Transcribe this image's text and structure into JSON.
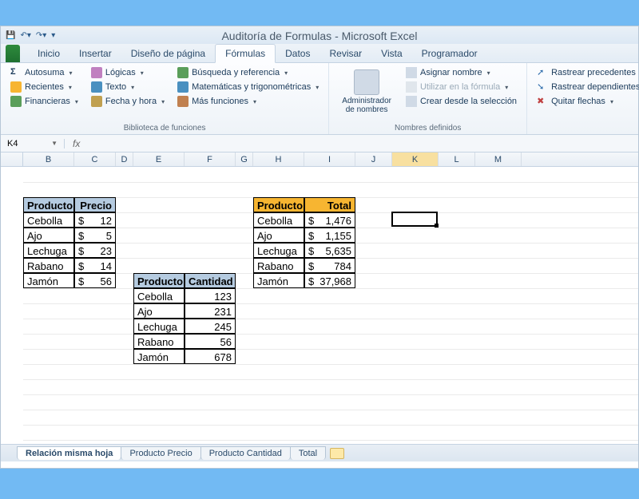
{
  "title": "Auditoría de Formulas - Microsoft Excel",
  "tabs": [
    "Inicio",
    "Insertar",
    "Diseño de página",
    "Fórmulas",
    "Datos",
    "Revisar",
    "Vista",
    "Programador"
  ],
  "activeTab": "Fórmulas",
  "ribbon": {
    "group1_label": "Biblioteca de funciones",
    "col1": [
      "Autosuma",
      "Recientes",
      "Financieras"
    ],
    "col2": [
      "Lógicas",
      "Texto",
      "Fecha y hora"
    ],
    "col3": [
      "Búsqueda y referencia",
      "Matemáticas y trigonométricas",
      "Más funciones"
    ],
    "nameMgr": "Administrador de nombres",
    "group2_label": "Nombres definidos",
    "col4": [
      "Asignar nombre",
      "Utilizar en la fórmula",
      "Crear desde la selección"
    ],
    "col5": [
      "Rastrear precedentes",
      "Rastrear dependientes",
      "Quitar flechas"
    ]
  },
  "nameBox": "K4",
  "fx": "fx",
  "columns": [
    "B",
    "C",
    "D",
    "E",
    "F",
    "G",
    "H",
    "I",
    "J",
    "K",
    "L",
    "M"
  ],
  "selectedCol": "K",
  "table1": {
    "headers": [
      "Producto",
      "Precio"
    ],
    "rows": [
      {
        "p": "Cebolla",
        "v": "12"
      },
      {
        "p": "Ajo",
        "v": "5"
      },
      {
        "p": "Lechuga",
        "v": "23"
      },
      {
        "p": "Rabano",
        "v": "14"
      },
      {
        "p": "Jamón",
        "v": "56"
      }
    ]
  },
  "table2": {
    "headers": [
      "Producto",
      "Cantidad"
    ],
    "rows": [
      {
        "p": "Cebolla",
        "v": "123"
      },
      {
        "p": "Ajo",
        "v": "231"
      },
      {
        "p": "Lechuga",
        "v": "245"
      },
      {
        "p": "Rabano",
        "v": "56"
      },
      {
        "p": "Jamón",
        "v": "678"
      }
    ]
  },
  "table3": {
    "headers": [
      "Producto",
      "Total"
    ],
    "rows": [
      {
        "p": "Cebolla",
        "v": "1,476"
      },
      {
        "p": "Ajo",
        "v": "1,155"
      },
      {
        "p": "Lechuga",
        "v": "5,635"
      },
      {
        "p": "Rabano",
        "v": "784"
      },
      {
        "p": "Jamón",
        "v": "37,968"
      }
    ]
  },
  "sheets": [
    "Relación misma hoja",
    "Producto Precio",
    "Producto Cantidad",
    "Total"
  ],
  "activeSheet": "Relación misma hoja",
  "dollar": "$"
}
